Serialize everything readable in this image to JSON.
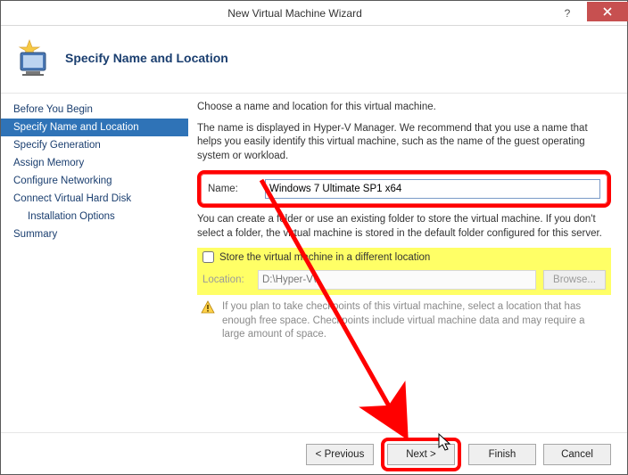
{
  "window": {
    "title": "New Virtual Machine Wizard"
  },
  "header": {
    "heading": "Specify Name and Location"
  },
  "sidebar": {
    "items": [
      {
        "label": "Before You Begin"
      },
      {
        "label": "Specify Name and Location"
      },
      {
        "label": "Specify Generation"
      },
      {
        "label": "Assign Memory"
      },
      {
        "label": "Configure Networking"
      },
      {
        "label": "Connect Virtual Hard Disk"
      },
      {
        "label": "Installation Options"
      },
      {
        "label": "Summary"
      }
    ]
  },
  "content": {
    "intro": "Choose a name and location for this virtual machine.",
    "desc": "The name is displayed in Hyper-V Manager. We recommend that you use a name that helps you easily identify this virtual machine, such as the name of the guest operating system or workload.",
    "name_label": "Name:",
    "name_value": "Windows 7 Ultimate SP1 x64",
    "folder_desc": "You can create a folder or use an existing folder to store the virtual machine. If you don't select a folder, the virtual machine is stored in the default folder configured for this server.",
    "store_checkbox_label": "Store the virtual machine in a different location",
    "location_label": "Location:",
    "location_value": "D:\\Hyper-V\\",
    "browse_label": "Browse...",
    "warning": "If you plan to take checkpoints of this virtual machine, select a location that has enough free space. Checkpoints include virtual machine data and may require a large amount of space."
  },
  "footer": {
    "previous": "< Previous",
    "next": "Next >",
    "finish": "Finish",
    "cancel": "Cancel"
  }
}
